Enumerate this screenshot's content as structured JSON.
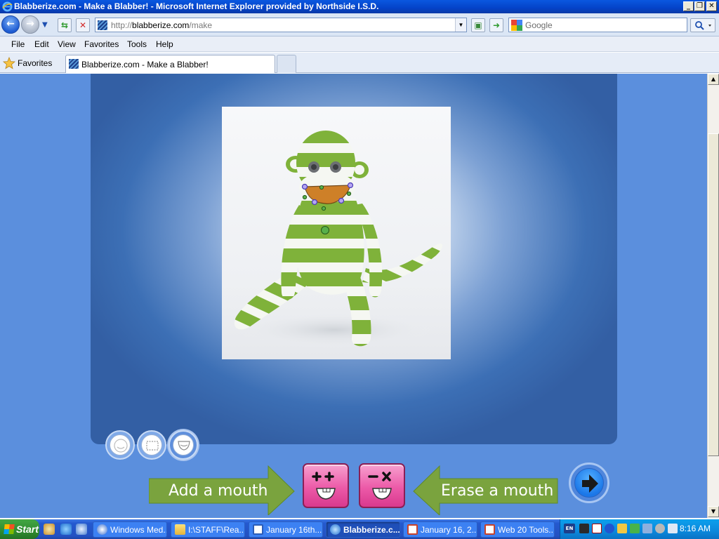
{
  "window": {
    "title": "Blabberize.com - Make a Blabber! - Microsoft Internet Explorer provided by Northside I.S.D."
  },
  "toolbar": {
    "address_prefix": "http://",
    "address_domain": "blabberize.com",
    "address_path": "/make",
    "search_placeholder": "Google",
    "back_icon": "back-arrow-icon",
    "forward_icon": "forward-arrow-icon"
  },
  "menu": [
    "File",
    "Edit",
    "View",
    "Favorites",
    "Tools",
    "Help"
  ],
  "favorites": {
    "label": "Favorites",
    "tab_title": "Blabberize.com - Make a Blabber!"
  },
  "content": {
    "photo_subject": "green-and-white sock monkey",
    "add_mouth_label": "Add a mouth",
    "erase_mouth_label": "Erase a mouth",
    "tools": [
      "face-tool-icon",
      "crop-tool-icon",
      "mouth-tool-icon"
    ],
    "active_tool": "mouth-tool-icon",
    "colors": {
      "page_bg": "#5b8fdd",
      "arrow_green": "#7aa33e",
      "pink_button": "#ec5aa8",
      "next_blue": "#1b77e8"
    }
  },
  "taskbar": {
    "start_label": "Start",
    "tasks": [
      "Windows Med...",
      "I:\\STAFF\\Rea...",
      "January 16th...",
      "Blabberize.c...",
      "January 16, 2...",
      "Web 20 Tools..."
    ],
    "active_task": "Blabberize.c...",
    "tray_badge": "EN",
    "clock": "8:16 AM"
  }
}
